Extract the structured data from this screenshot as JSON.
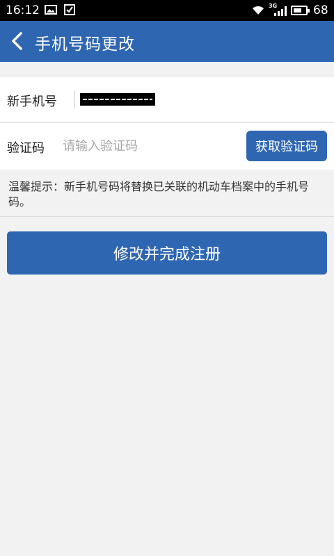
{
  "status_bar": {
    "time": "16:12",
    "network": "3G",
    "battery": "68",
    "battery_level": 0.68,
    "icons": [
      "gallery-icon",
      "download-check-icon",
      "wifi-icon",
      "signal-icon",
      "battery-icon"
    ]
  },
  "appbar": {
    "title": "手机号码更改",
    "back_icon": "chevron-left-icon"
  },
  "form": {
    "phone_label": "新手机号",
    "phone_value": "",
    "code_label": "验证码",
    "code_placeholder": "请输入验证码",
    "get_code_label": "获取验证码"
  },
  "tip": {
    "text": "温馨提示：新手机号码将替换已关联的机动车档案中的手机号码。"
  },
  "submit_label": "修改并完成注册",
  "colors": {
    "primary": "#2f66b2",
    "background": "#f2f2f2"
  }
}
